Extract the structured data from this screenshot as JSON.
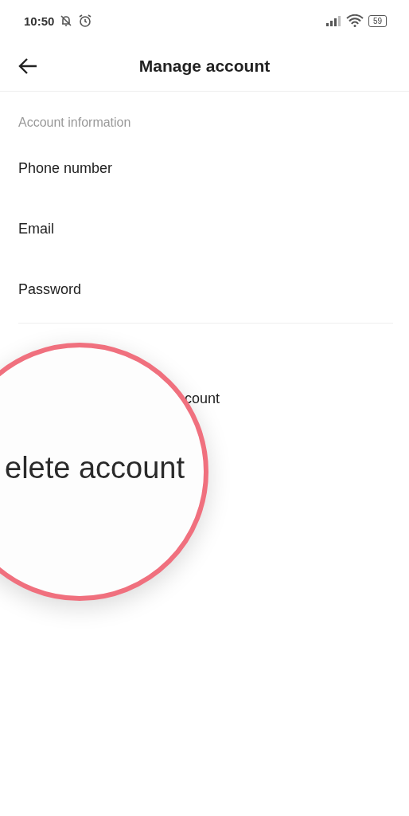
{
  "status_bar": {
    "time": "10:50",
    "battery": "59"
  },
  "header": {
    "title": "Manage account"
  },
  "section": {
    "label": "Account information",
    "items": [
      "Phone number",
      "Email",
      "Password"
    ]
  },
  "covered_item": {
    "label": "count"
  },
  "magnifier": {
    "text": "elete account"
  }
}
